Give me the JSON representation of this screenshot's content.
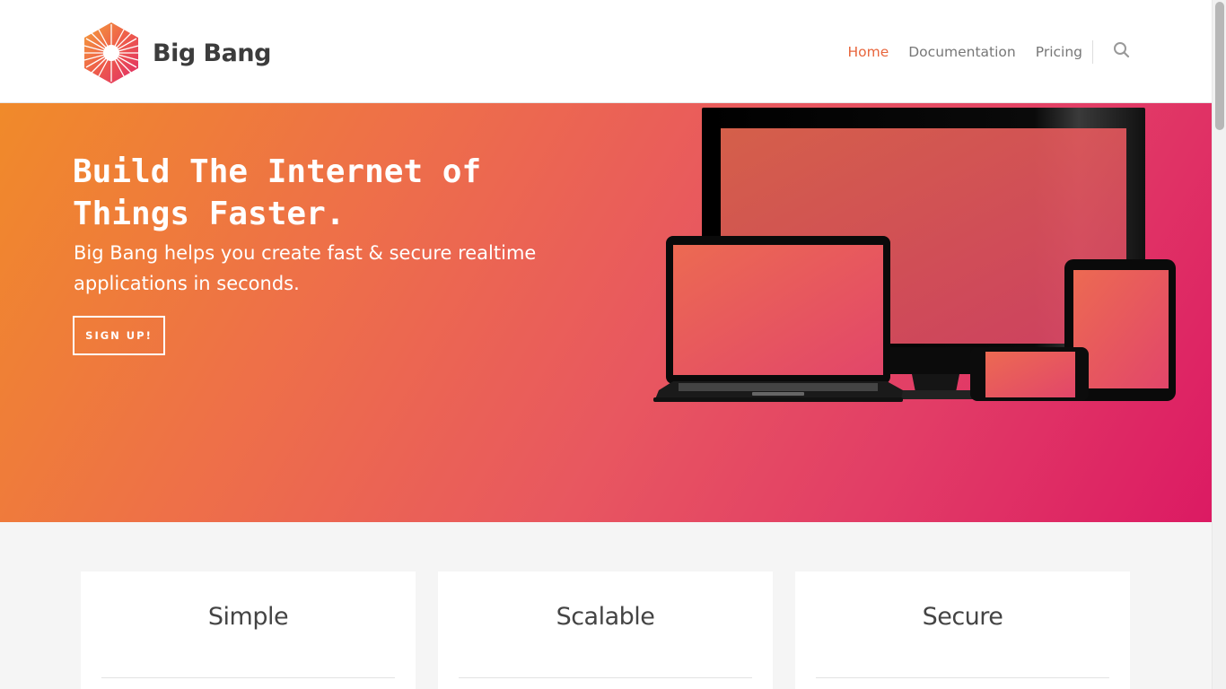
{
  "brand": {
    "name": "Big Bang"
  },
  "nav": {
    "items": [
      {
        "label": "Home",
        "active": true
      },
      {
        "label": "Documentation",
        "active": false
      },
      {
        "label": "Pricing",
        "active": false
      }
    ],
    "search_icon": "search-icon"
  },
  "hero": {
    "title": "Build The Internet of Things Faster.",
    "subtitle": "Big Bang helps you create fast & secure realtime applications in seconds.",
    "cta_label": "SIGN UP!"
  },
  "features": [
    {
      "title": "Simple"
    },
    {
      "title": "Scalable"
    },
    {
      "title": "Secure"
    }
  ],
  "colors": {
    "accent": "#e8663d",
    "gradient_start": "#f08a2a",
    "gradient_end": "#dc1a63"
  }
}
